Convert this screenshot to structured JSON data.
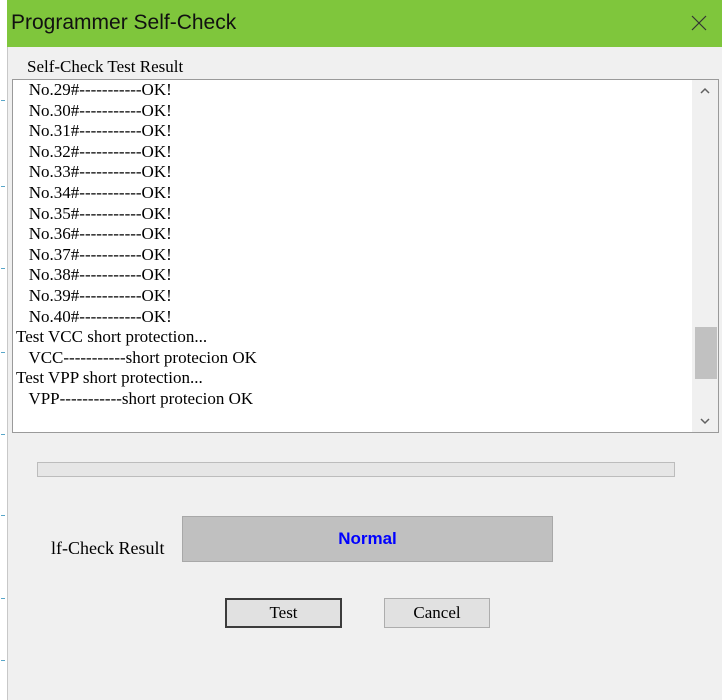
{
  "window": {
    "title": "Programmer Self-Check",
    "close_glyph": "✕"
  },
  "test_result_group": {
    "label": "Self-Check Test Result",
    "lines": [
      "   No.29#-----------OK!",
      "   No.30#-----------OK!",
      "   No.31#-----------OK!",
      "   No.32#-----------OK!",
      "   No.33#-----------OK!",
      "   No.34#-----------OK!",
      "   No.35#-----------OK!",
      "   No.36#-----------OK!",
      "   No.37#-----------OK!",
      "   No.38#-----------OK!",
      "   No.39#-----------OK!",
      "   No.40#-----------OK!",
      "Test VCC short protection...",
      "   VCC-----------short protecion OK",
      "Test VPP short protection...",
      "   VPP-----------short protecion OK"
    ],
    "scroll_fraction": 0.88
  },
  "progress": {
    "fraction": 0.0
  },
  "result": {
    "label": "lf-Check Result",
    "value": "Normal",
    "value_color": "#0000ff"
  },
  "buttons": {
    "test_label": "Test",
    "cancel_label": "Cancel"
  },
  "colors": {
    "title_bar": "#7fc63c",
    "result_box": "#c0c0c0"
  }
}
